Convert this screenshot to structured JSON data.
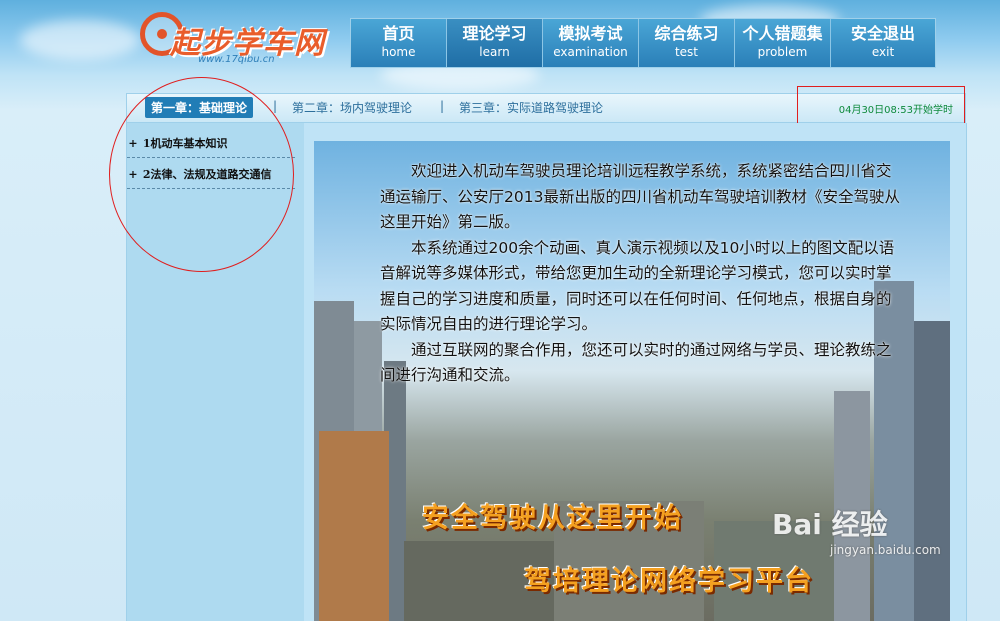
{
  "logo": {
    "name": "起步学车网",
    "url": "www.17qibu.cn"
  },
  "nav": [
    {
      "cn": "首页",
      "en": "home"
    },
    {
      "cn": "理论学习",
      "en": "learn"
    },
    {
      "cn": "模拟考试",
      "en": "examination"
    },
    {
      "cn": "综合练习",
      "en": "test"
    },
    {
      "cn": "个人错题集",
      "en": "problem"
    },
    {
      "cn": "安全退出",
      "en": "exit"
    }
  ],
  "nav_active": "理论学习",
  "tabs": [
    "第一章：基础理论",
    "第二章：场内驾驶理论",
    "第三章：实际道路驾驶理论"
  ],
  "tab_separator": "|",
  "start_time": "04月30日08:53开始学时",
  "sidebar": [
    {
      "prefix": "+",
      "label": "1机动车基本知识"
    },
    {
      "prefix": "+",
      "label": "2法律、法规及道路交通信"
    }
  ],
  "intro": [
    "欢迎进入机动车驾驶员理论培训远程教学系统，系统紧密结合四川省交通运输厅、公安厅2013最新出版的四川省机动车驾驶培训教材《安全驾驶从这里开始》第二版。",
    "本系统通过200余个动画、真人演示视频以及10小时以上的图文配以语音解说等多媒体形式，带给您更加生动的全新理论学习模式，您可以实时掌握自己的学习进度和质量，同时还可以在任何时间、任何地点，根据自身的实际情况自由的进行理论学习。",
    "通过互联网的聚合作用，您还可以实时的通过网络与学员、理论教练之间进行沟通和交流。"
  ],
  "slogans": [
    "安全驾驶从这里开始",
    "驾培理论网络学习平台"
  ],
  "watermark": {
    "brand": "Bai 经验",
    "url": "jingyan.baidu.com"
  },
  "colors": {
    "accent": "#217db6",
    "time_text": "#0e8a3c",
    "annotation": "#e01e1e",
    "slogan": "#f4a020"
  }
}
